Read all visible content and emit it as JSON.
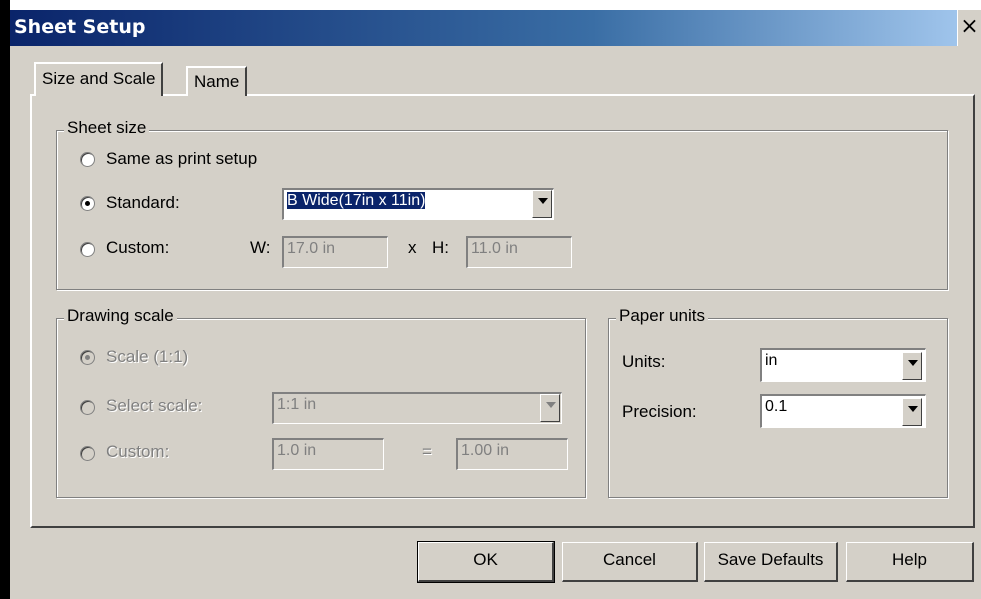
{
  "dialog": {
    "title": "Sheet Setup",
    "close": "×"
  },
  "tabs": [
    {
      "label": "Size and Scale",
      "active": true
    },
    {
      "label": "Name",
      "active": false
    }
  ],
  "sheet_size": {
    "legend": "Sheet size",
    "same_as_print": "Same as print setup",
    "standard_label": "Standard:",
    "standard_value": "B Wide(17in x 11in)",
    "custom_label": "Custom:",
    "w_label": "W:",
    "w_value": "17.0 in",
    "x_sep": "x",
    "h_label": "H:",
    "h_value": "11.0 in",
    "selected": "standard"
  },
  "drawing_scale": {
    "legend": "Drawing scale",
    "scale_label": "Scale (1:1)",
    "select_label": "Select scale:",
    "select_value": "1:1 in",
    "custom_label": "Custom:",
    "custom_left": "1.0 in",
    "equals": "=",
    "custom_right": "1.00 in"
  },
  "paper_units": {
    "legend": "Paper units",
    "units_label": "Units:",
    "units_value": "in",
    "precision_label": "Precision:",
    "precision_value": "0.1"
  },
  "buttons": {
    "ok": "OK",
    "cancel": "Cancel",
    "save_defaults": "Save Defaults",
    "help": "Help"
  }
}
